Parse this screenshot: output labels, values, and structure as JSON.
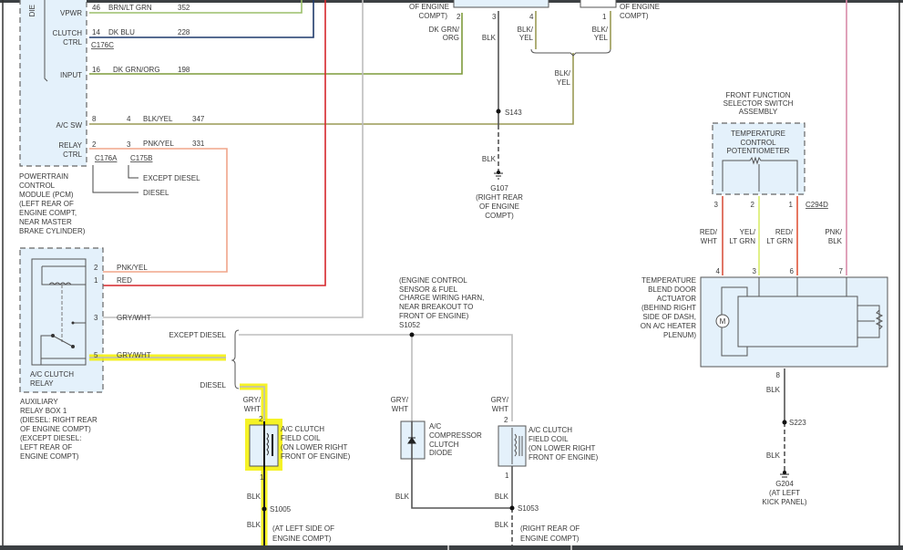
{
  "colors": {
    "brn_lt_grn": "#9bbf6a",
    "dk_blu": "#1f3a6b",
    "dk_grn_org": "#7f9b3c",
    "blk_yel": "#9a9a55",
    "pnk_yel": "#f0a58a",
    "red": "#d6262b",
    "gry_wht": "#bdbdbd",
    "blk": "#555555",
    "red_wht": "#d9533f",
    "yel_lt_grn": "#d8ec6a",
    "red_lt_grn": "#e0563a",
    "pnk_blk": "#d98aa8",
    "highlight": "#f3f000",
    "module_fill": "#e4f1fb"
  },
  "pcm": {
    "side_label": "DIE",
    "vpwr": {
      "label": "VPWR",
      "pin": "46",
      "wire": "BRN/LT GRN",
      "circuit": "352"
    },
    "clutch": {
      "label1": "CLUTCH",
      "label2": "CTRL",
      "pin": "14",
      "wire": "DK BLU",
      "circuit": "228",
      "connector": "C176C"
    },
    "input": {
      "label": "INPUT",
      "pin": "16",
      "wire": "DK GRN/ORG",
      "circuit": "198"
    },
    "acsw": {
      "label": "A/C SW",
      "pin": "8",
      "pin2": "4",
      "wire": "BLK/YEL",
      "circuit": "347"
    },
    "relay": {
      "label1": "RELAY",
      "label2": "CTRL",
      "pin": "2",
      "pin2": "3",
      "wire": "PNK/YEL",
      "circuit": "331"
    },
    "conn_a": "C176A",
    "conn_b": "C175B",
    "except_diesel": "EXCEPT DIESEL",
    "diesel": "DIESEL",
    "caption": [
      "POWERTRAIN",
      "CONTROL",
      "MODULE (PCM)",
      "(LEFT REAR OF",
      "ENGINE COMPT,",
      "NEAR MASTER",
      "BRAKE CYLINDER)"
    ]
  },
  "relay_box": {
    "pin2": "2",
    "pin2_wire": "PNK/YEL",
    "pin1": "1",
    "pin1_wire": "RED",
    "pin3": "3",
    "pin3_wire": "GRY/WHT",
    "pin5": "5",
    "pin5_wire": "GRY/WHT",
    "relay_label": [
      "A/C CLUTCH",
      "RELAY"
    ],
    "caption": [
      "AUXILIARY",
      "RELAY BOX 1",
      "(DIESEL: RIGHT REAR",
      "OF ENGINE COMPT)",
      "(EXCEPT DIESEL:",
      "LEFT REAR OF",
      "ENGINE COMPT)"
    ]
  },
  "branch": {
    "except_diesel": "EXCEPT DIESEL",
    "diesel": "DIESEL"
  },
  "coil_diesel": {
    "wire_top": [
      "GRY/",
      "WHT"
    ],
    "pin2": "2",
    "pin1": "1",
    "label": [
      "A/C CLUTCH",
      "FIELD COIL",
      "(ON LOWER RIGHT",
      "FRONT OF ENGINE)"
    ],
    "wire_bot": "BLK",
    "splice": "S1005",
    "wire_bot2": "BLK",
    "location": [
      "(AT LEFT SIDE OF",
      "ENGINE COMPT)"
    ]
  },
  "splice_s1052": {
    "label": [
      "(ENGINE CONTROL",
      "SENSOR & FUEL",
      "CHARGE WIRING HARN,",
      "NEAR BREAKOUT TO",
      "FRONT OF ENGINE)",
      "S1052"
    ]
  },
  "diode": {
    "wire_top": [
      "GRY/",
      "WHT"
    ],
    "label": [
      "A/C",
      "COMPRESSOR",
      "CLUTCH",
      "DIODE"
    ],
    "wire_bot": "BLK"
  },
  "coil2": {
    "wire_top": [
      "GRY/",
      "WHT"
    ],
    "pin2": "2",
    "pin1": "1",
    "label": [
      "A/C CLUTCH",
      "FIELD COIL",
      "(ON LOWER RIGHT",
      "FRONT OF ENGINE)"
    ],
    "wire_bot": "BLK",
    "splice": "S1053",
    "wire_bot2": "BLK",
    "location": [
      "(RIGHT REAR OF",
      "ENGINE COMPT)"
    ]
  },
  "top_mid": {
    "left_caption": [
      "OF ENGINE",
      "COMPT)"
    ],
    "pin2": "2",
    "pin3": "3",
    "pin4": "4",
    "right_pin1": "1",
    "right_caption": [
      "OF ENGINE",
      "COMPT)"
    ],
    "wire2": [
      "DK GRN/",
      "ORG"
    ],
    "wire3": "BLK",
    "wire4": [
      "BLK/",
      "YEL"
    ],
    "wire1": [
      "BLK/",
      "YEL"
    ],
    "merged": [
      "BLK/",
      "YEL"
    ],
    "splice": "S143",
    "wire_gnd": "BLK",
    "ground": [
      "G107",
      "(RIGHT REAR",
      "OF ENGINE",
      "COMPT)"
    ]
  },
  "selector": {
    "title": [
      "FRONT FUNCTION",
      "SELECTOR SWITCH",
      "ASSEMBLY"
    ],
    "pot_label": [
      "TEMPERATURE",
      "CONTROL",
      "POTENTIOMETER"
    ],
    "pin3": "3",
    "pin2": "2",
    "pin1": "1",
    "connector": "C294D",
    "wires": [
      [
        "RED/",
        "WHT"
      ],
      [
        "YEL/",
        "LT GRN"
      ],
      [
        "RED/",
        "LT GRN"
      ],
      [
        "PNK/",
        "BLK"
      ]
    ]
  },
  "actuator": {
    "label": [
      "TEMPERATURE",
      "BLEND DOOR",
      "ACTUATOR",
      "(BEHIND RIGHT",
      "SIDE OF DASH,",
      "ON A/C HEATER",
      "PLENUM)"
    ],
    "pins": [
      "4",
      "3",
      "6",
      "7"
    ],
    "motor": "M",
    "pin8": "8",
    "wire": "BLK",
    "splice": "S223",
    "wire2": "BLK",
    "ground": [
      "G204",
      "(AT LEFT",
      "KICK PANEL)"
    ]
  }
}
